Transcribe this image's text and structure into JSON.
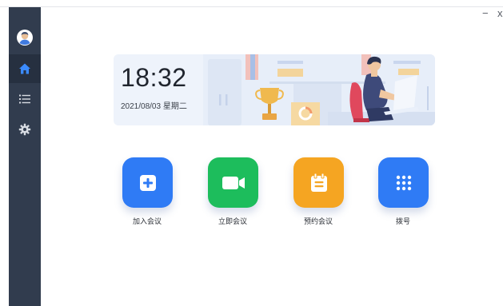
{
  "window": {
    "minimize": "−",
    "close": "x"
  },
  "sidebar": {
    "items": [
      {
        "icon": "avatar-icon"
      },
      {
        "icon": "home-icon",
        "active": true
      },
      {
        "icon": "list-icon"
      },
      {
        "icon": "gear-icon"
      }
    ],
    "color": "#313c4e",
    "active_color": "#263040",
    "active_icon_color": "#3b8bff"
  },
  "banner": {
    "time": "18:32",
    "date": "2021/08/03 星期二"
  },
  "actions": [
    {
      "label": "加入会议",
      "icon": "plus-icon",
      "color": "#2f7bf5"
    },
    {
      "label": "立即会议",
      "icon": "video-camera-icon",
      "color": "#1dbd5c"
    },
    {
      "label": "预约会议",
      "icon": "calendar-icon",
      "color": "#f5a522"
    },
    {
      "label": "拨号",
      "icon": "keypad-icon",
      "color": "#2f7bf5"
    }
  ]
}
